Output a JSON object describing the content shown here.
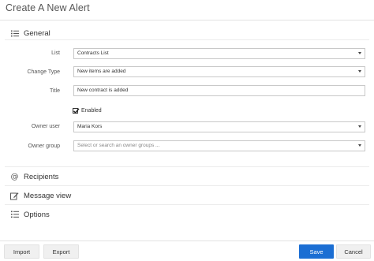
{
  "dialog": {
    "title": "Create A New Alert"
  },
  "sections": {
    "general": "General",
    "recipients": "Recipients",
    "message_view": "Message view",
    "options": "Options"
  },
  "fields": {
    "list": {
      "label": "List",
      "value": "Contracts List"
    },
    "change_type": {
      "label": "Change Type",
      "value": "New items are added"
    },
    "title": {
      "label": "Title",
      "value": "New contract is added"
    },
    "enabled": {
      "label": "Enabled",
      "checked": true
    },
    "owner_user": {
      "label": "Owner user",
      "value": "Maria Kors"
    },
    "owner_group": {
      "label": "Owner group",
      "placeholder": "Select or search an owner groups ..."
    }
  },
  "footer": {
    "import": "Import",
    "export": "Export",
    "save": "Save",
    "cancel": "Cancel"
  },
  "colors": {
    "primary": "#1b6ed3"
  },
  "icons": {
    "general": "list-icon",
    "recipients": "at-sign-icon",
    "message_view": "edit-icon",
    "options": "options-list-icon"
  }
}
